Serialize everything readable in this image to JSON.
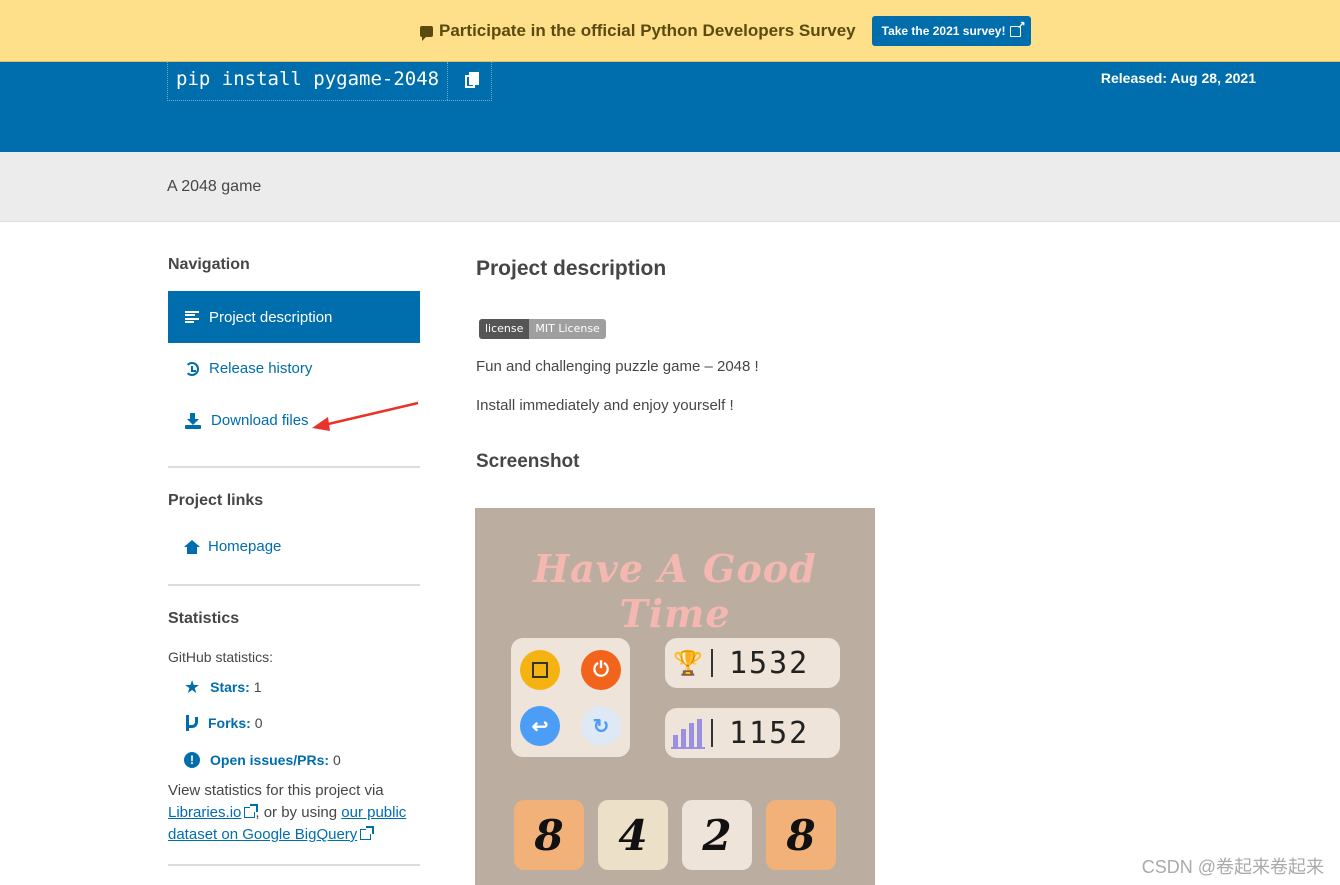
{
  "banner": {
    "text": "Participate in the official Python Developers Survey",
    "button_label": "Take the 2021 survey!"
  },
  "header": {
    "pip_command": "pip install pygame-2048",
    "released": "Released: Aug 28, 2021"
  },
  "summary": "A 2048 game",
  "sidebar": {
    "navigation_heading": "Navigation",
    "nav_items": [
      {
        "label": "Project description",
        "icon": "bars-icon",
        "active": true
      },
      {
        "label": "Release history",
        "icon": "history-icon",
        "active": false
      },
      {
        "label": "Download files",
        "icon": "download-icon",
        "active": false
      }
    ],
    "project_links_heading": "Project links",
    "homepage_label": "Homepage",
    "statistics_heading": "Statistics",
    "github_stats_label": "GitHub statistics:",
    "stats": [
      {
        "label": "Stars:",
        "value": "1",
        "icon": "star-icon"
      },
      {
        "label": "Forks:",
        "value": "0",
        "icon": "fork-icon"
      },
      {
        "label": "Open issues/PRs:",
        "value": "0",
        "icon": "issue-icon"
      }
    ],
    "stats_text_1": "View statistics for this project via",
    "libraries_link": "Libraries.io",
    "stats_text_2": ", or by using",
    "bigquery_link_1": "our public",
    "bigquery_link_2": "dataset on Google BigQuery"
  },
  "main": {
    "heading": "Project description",
    "badge_left": "license",
    "badge_right": "MIT License",
    "line1": "Fun and challenging puzzle game – 2048 !",
    "line2": "Install immediately and enjoy yourself !",
    "screenshot_heading": "Screenshot"
  },
  "game": {
    "title": "Have A Good Time",
    "best_score": "1532",
    "current_score": "1152",
    "tiles": [
      "8",
      "4",
      "2",
      "8"
    ],
    "colors": {
      "background": "#bbada0",
      "panel": "#eee4da",
      "tile_8": "#f2b179",
      "tile_4": "#ede0c8",
      "tile_2": "#eee4da"
    }
  },
  "watermark": "CSDN @卷起来卷起来",
  "colors": {
    "accent": "#006dad",
    "banner": "#ffe08a",
    "annotation": "#e8322b"
  }
}
